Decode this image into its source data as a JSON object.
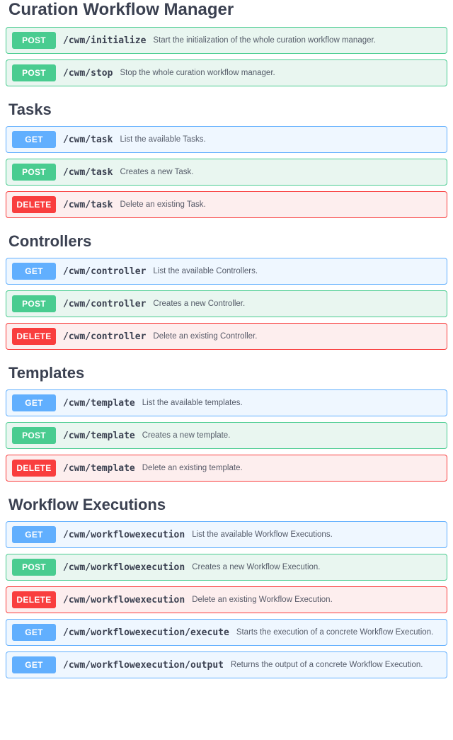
{
  "sections": [
    {
      "title": "Curation Workflow Manager",
      "topCut": true,
      "ops": [
        {
          "method": "POST",
          "path": "/cwm/initialize",
          "desc": "Start the initialization of the whole curation workflow manager."
        },
        {
          "method": "POST",
          "path": "/cwm/stop",
          "desc": "Stop the whole curation workflow manager."
        }
      ]
    },
    {
      "title": "Tasks",
      "ops": [
        {
          "method": "GET",
          "path": "/cwm/task",
          "desc": "List the available Tasks."
        },
        {
          "method": "POST",
          "path": "/cwm/task",
          "desc": "Creates a new Task."
        },
        {
          "method": "DELETE",
          "path": "/cwm/task",
          "desc": "Delete an existing Task."
        }
      ]
    },
    {
      "title": "Controllers",
      "ops": [
        {
          "method": "GET",
          "path": "/cwm/controller",
          "desc": "List the available Controllers."
        },
        {
          "method": "POST",
          "path": "/cwm/controller",
          "desc": "Creates a new Controller."
        },
        {
          "method": "DELETE",
          "path": "/cwm/controller",
          "desc": "Delete an existing Controller."
        }
      ]
    },
    {
      "title": "Templates",
      "ops": [
        {
          "method": "GET",
          "path": "/cwm/template",
          "desc": "List the available templates."
        },
        {
          "method": "POST",
          "path": "/cwm/template",
          "desc": "Creates a new template."
        },
        {
          "method": "DELETE",
          "path": "/cwm/template",
          "desc": "Delete an existing template."
        }
      ]
    },
    {
      "title": "Workflow Executions",
      "ops": [
        {
          "method": "GET",
          "path": "/cwm/workflowexecution",
          "desc": "List the available Workflow Executions."
        },
        {
          "method": "POST",
          "path": "/cwm/workflowexecution",
          "desc": "Creates a new Workflow Execution."
        },
        {
          "method": "DELETE",
          "path": "/cwm/workflowexecution",
          "desc": "Delete an existing Workflow Execution."
        },
        {
          "method": "GET",
          "path": "/cwm/workflowexecution/execute",
          "desc": "Starts the execution of a concrete Workflow Execution."
        },
        {
          "method": "GET",
          "path": "/cwm/workflowexecution/output",
          "desc": "Returns the output of a concrete Workflow Execution."
        }
      ]
    }
  ]
}
